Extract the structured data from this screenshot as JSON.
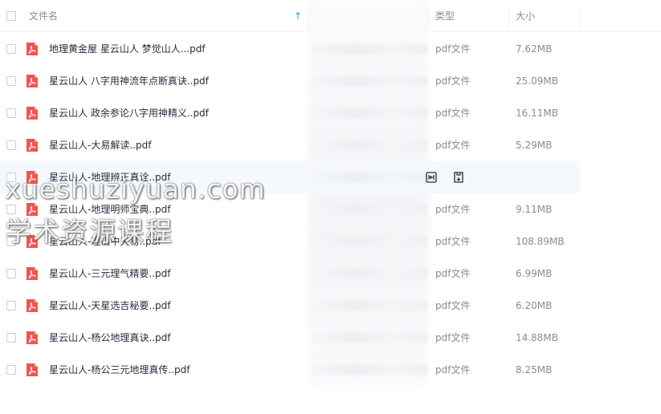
{
  "header": {
    "name_label": "文件名",
    "type_label": "类型",
    "size_label": "大小",
    "sort_arrow": "↑"
  },
  "files": [
    {
      "name": "地理黄金屋 星云山人 梦觉山人...pdf",
      "type": "pdf文件",
      "size": "7.62MB"
    },
    {
      "name": "星云山人 八字用神流年点断真诀..pdf",
      "type": "pdf文件",
      "size": "25.09MB"
    },
    {
      "name": "星云山人 政余参论八字用神精义..pdf",
      "type": "pdf文件",
      "size": "16.11MB"
    },
    {
      "name": "星云山人-大易解读..pdf",
      "type": "pdf文件",
      "size": "5.29MB"
    },
    {
      "name": "星云山人-地理辨正真诠..pdf",
      "type": "",
      "size": ""
    },
    {
      "name": "星云山人-地理明师宝典..pdf",
      "type": "pdf文件",
      "size": "9.11MB"
    },
    {
      "name": "星云山人-理山中天易..pdf",
      "type": "pdf文件",
      "size": "108.89MB"
    },
    {
      "name": "星云山人-三元理气精要..pdf",
      "type": "pdf文件",
      "size": "6.99MB"
    },
    {
      "name": "星云山人-天星选吉秘要..pdf",
      "type": "pdf文件",
      "size": "6.20MB"
    },
    {
      "name": "星云山人-杨公地理真诀..pdf",
      "type": "pdf文件",
      "size": "14.88MB"
    },
    {
      "name": "星云山人-杨公三元地理真传..pdf",
      "type": "pdf文件",
      "size": "8.25MB"
    }
  ],
  "watermark": {
    "line1": "xueshuziyuan.com",
    "line2": "学术资源课程"
  },
  "colors": {
    "accent": "#06a7ff",
    "pdf_icon": "#f0554e",
    "hover_row": "#f5f8fd"
  }
}
